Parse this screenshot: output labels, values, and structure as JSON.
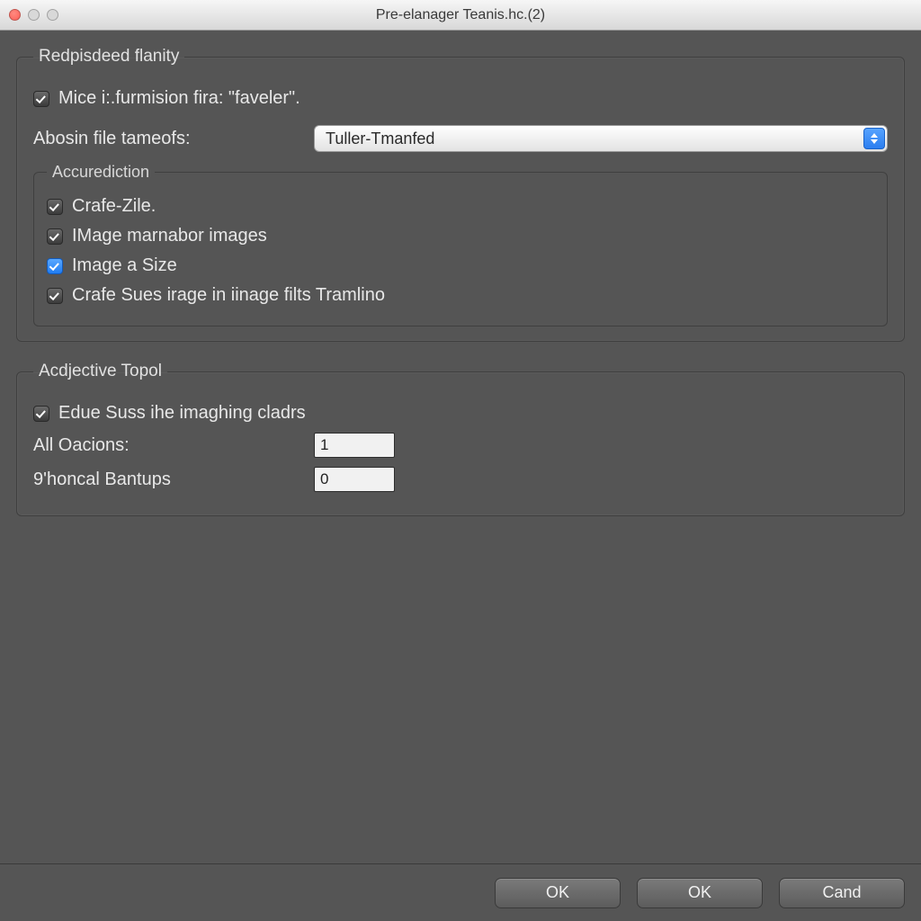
{
  "window": {
    "title": "Pre-elanager Teanis.hc.(2)"
  },
  "group1": {
    "legend": "Redpisdeed flanity",
    "check1_label": "Mice i:.furmision fira: \"faveler\".",
    "dropdown_label": "Abosin file tameofs:",
    "dropdown_value": "Tuller-Tmanfed",
    "inner_legend": "Accurediction",
    "inner_check1": "Crafe-Zile.",
    "inner_check2": "IMage marnabor images",
    "inner_check3": "Image a Size",
    "inner_check4": "Crafe Sues irage in iinage filts Tramlino"
  },
  "group2": {
    "legend": "Acdjective Topol",
    "check1_label": "Edue Suss ihe imaghing cladrs",
    "num1_label": "All Oacions:",
    "num1_value": "1",
    "num2_label": "9'honcal Bantups",
    "num2_value": "0"
  },
  "buttons": {
    "ok1": "OK",
    "ok2": "OK",
    "cancel": "Cand"
  }
}
